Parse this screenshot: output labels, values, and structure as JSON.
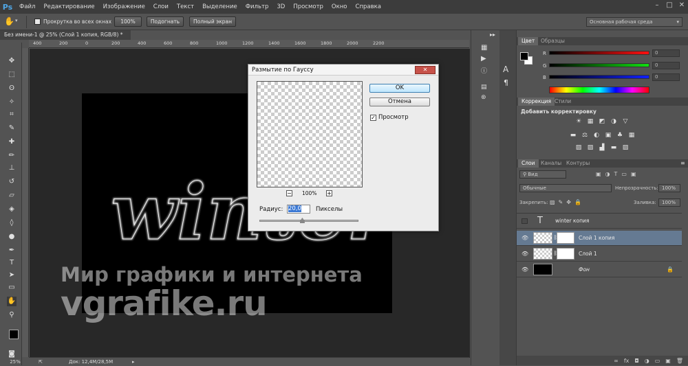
{
  "app": {
    "logo": "Ps"
  },
  "menu": [
    "Файл",
    "Редактирование",
    "Изображение",
    "Слои",
    "Текст",
    "Выделение",
    "Фильтр",
    "3D",
    "Просмотр",
    "Окно",
    "Справка"
  ],
  "window_controls": [
    "–",
    "□",
    "✕"
  ],
  "options_bar": {
    "tool_icon": "hand-icon",
    "scroll_all_label": "Прокрутка во всех окнах",
    "btn_100": "100%",
    "btn_fit": "Подогнать",
    "btn_fullscreen": "Полный экран",
    "workspace": "Основная рабочая среда"
  },
  "doc_tab": {
    "title": "Без имени-1 @ 25% (Слой 1 копия, RGB/8) *",
    "close": "×"
  },
  "ruler_labels": [
    "400",
    "200",
    "0",
    "200",
    "400",
    "600",
    "800",
    "1000",
    "1200",
    "1400",
    "1600",
    "1800",
    "2000",
    "2200"
  ],
  "canvas": {
    "art_text": "winter",
    "watermark_line1": "Мир графики и интернета",
    "watermark_line2": "vgrafike.ru"
  },
  "status": {
    "zoom": "25%",
    "doc": "Док: 12,4M/28,5M"
  },
  "dialog": {
    "title": "Размытие по Гауссу",
    "ok": "OK",
    "cancel": "Отмена",
    "preview_label": "Просмотр",
    "preview_checked": true,
    "zoom_level": "100%",
    "zoom_minus": "−",
    "zoom_plus": "+",
    "radius_label": "Радиус:",
    "radius_value": "20,0",
    "radius_unit": "Пикселы",
    "slider_fraction": 0.43
  },
  "panels": {
    "color": {
      "tabs": [
        "Цвет",
        "Образцы"
      ],
      "channels": [
        {
          "label": "R",
          "value": "0",
          "color": "#e02020"
        },
        {
          "label": "G",
          "value": "0",
          "color": "#20c020"
        },
        {
          "label": "B",
          "value": "0",
          "color": "#2030e0"
        }
      ],
      "foreground": "#000000",
      "background": "#ffffff"
    },
    "adjustments": {
      "tabs": [
        "Коррекция",
        "Стили"
      ],
      "heading": "Добавить корректировку",
      "row1": [
        "☀",
        "▦",
        "◩",
        "◑",
        "▽"
      ],
      "row2": [
        "▬",
        "⚖",
        "◐",
        "▣",
        "♣",
        "▦"
      ],
      "row3": [
        "▨",
        "▨",
        "▟",
        "▬",
        "▨"
      ]
    },
    "layers": {
      "tabs": [
        "Слои",
        "Каналы",
        "Контуры"
      ],
      "filter_kind": "Вид",
      "blend_mode": "Обычные",
      "opacity_label": "Непрозрачность:",
      "opacity_value": "100%",
      "lock_label": "Закрепить:",
      "fill_label": "Заливка:",
      "fill_value": "100%",
      "items": [
        {
          "name": "winter копия",
          "type": "text",
          "visible": false,
          "selected": false
        },
        {
          "name": "Слой 1 копия",
          "type": "masked",
          "visible": true,
          "selected": true
        },
        {
          "name": "Слой 1",
          "type": "masked",
          "visible": true,
          "selected": false
        },
        {
          "name": "Фон",
          "type": "background",
          "visible": true,
          "selected": false
        }
      ],
      "footer_icons": [
        "∞",
        "fx",
        "◘",
        "◑",
        "▭",
        "▣",
        "🗑"
      ]
    }
  }
}
